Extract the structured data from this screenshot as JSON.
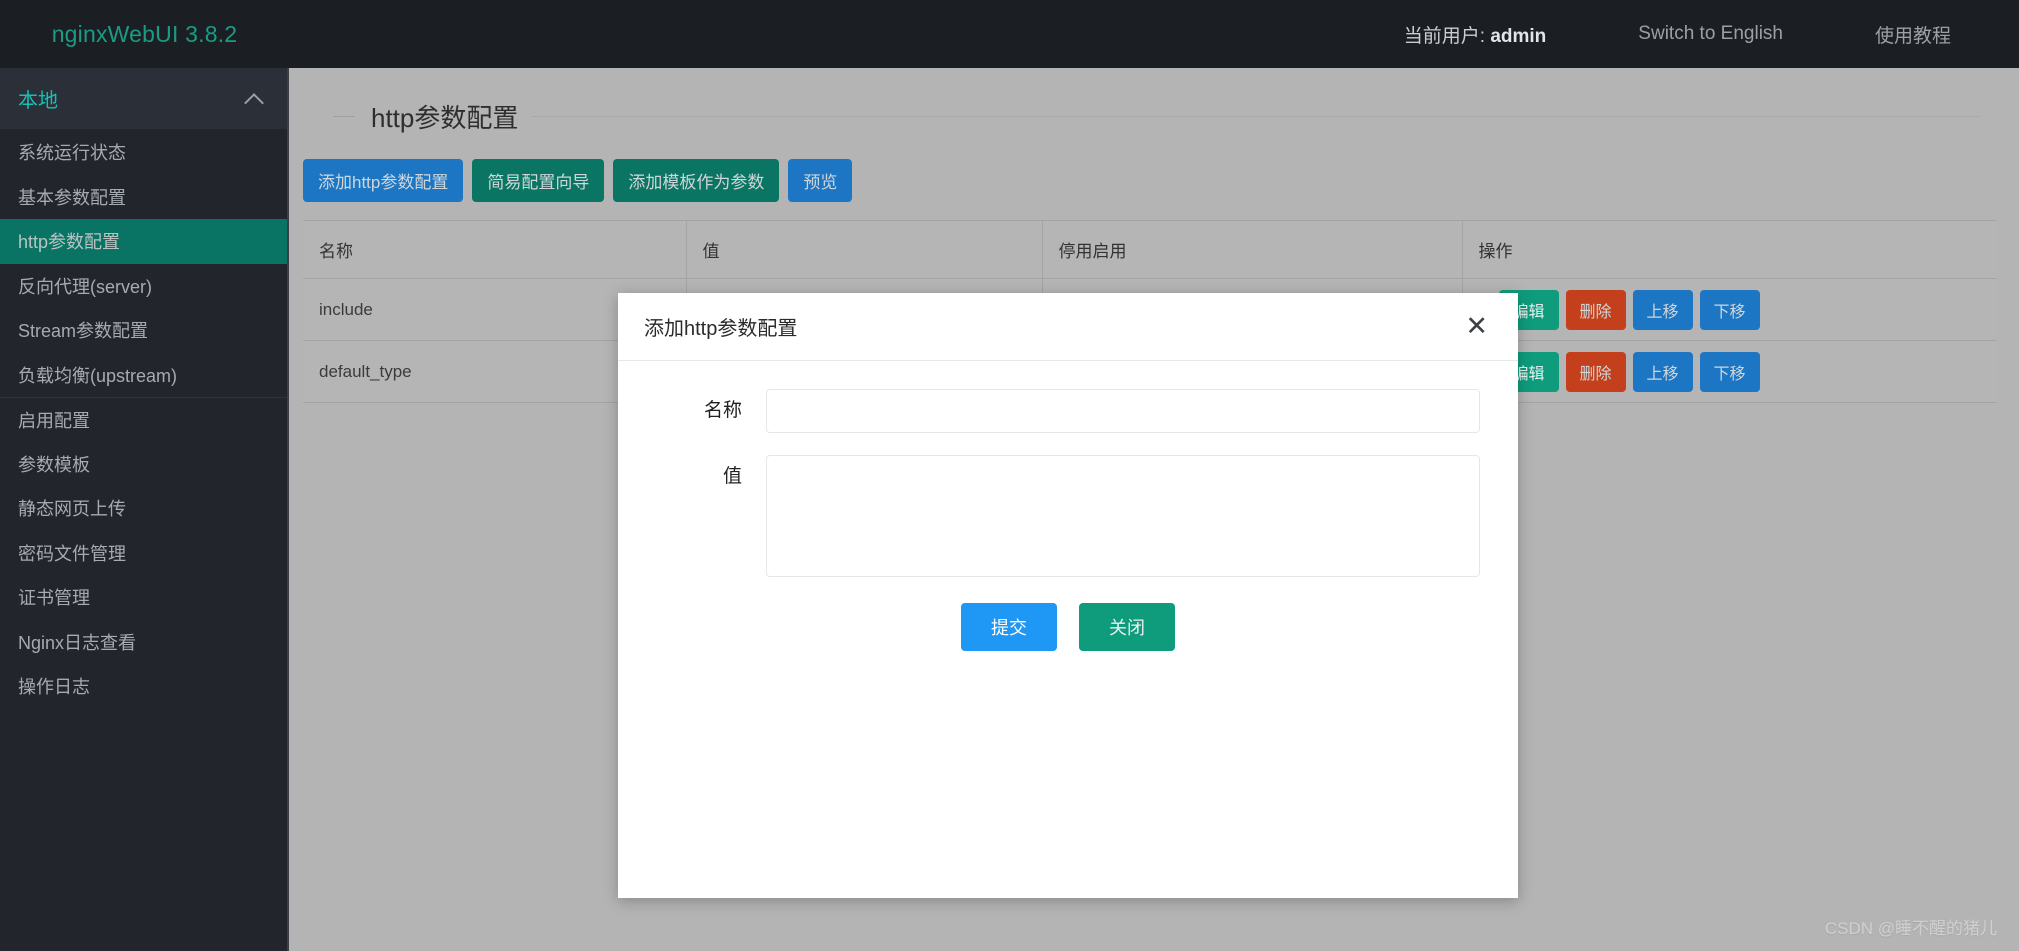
{
  "header": {
    "brand": "nginxWebUI 3.8.2",
    "nav": [
      {
        "label": "当前用户: admin",
        "name": "current-user"
      },
      {
        "label": "Switch to English",
        "name": "switch-language"
      },
      {
        "label": "使用教程",
        "name": "tutorial-link"
      }
    ]
  },
  "sidebar": {
    "section_label": "本地",
    "items": [
      {
        "label": "系统运行状态",
        "active": false
      },
      {
        "label": "基本参数配置",
        "active": false
      },
      {
        "label": "http参数配置",
        "active": true
      },
      {
        "label": "反向代理(server)",
        "active": false
      },
      {
        "label": "Stream参数配置",
        "active": false
      },
      {
        "label": "负载均衡(upstream)",
        "active": false
      },
      {
        "label": "启用配置",
        "active": false
      },
      {
        "label": "参数模板",
        "active": false
      },
      {
        "label": "静态网页上传",
        "active": false
      },
      {
        "label": "密码文件管理",
        "active": false
      },
      {
        "label": "证书管理",
        "active": false
      },
      {
        "label": "Nginx日志查看",
        "active": false
      },
      {
        "label": "操作日志",
        "active": false
      }
    ]
  },
  "main": {
    "page_title": "http参数配置",
    "toolbar": [
      {
        "label": "添加http参数配置",
        "style": "blue"
      },
      {
        "label": "简易配置向导",
        "style": "teal"
      },
      {
        "label": "添加模板作为参数",
        "style": "teal"
      },
      {
        "label": "预览",
        "style": "blue"
      }
    ],
    "table": {
      "columns": [
        "名称",
        "值",
        "停用启用",
        "操作"
      ],
      "row_actions": [
        {
          "label": "编辑",
          "style": "green"
        },
        {
          "label": "删除",
          "style": "red"
        },
        {
          "label": "上移",
          "style": "blue"
        },
        {
          "label": "下移",
          "style": "blue"
        }
      ],
      "rows": [
        {
          "name": "include",
          "value": "",
          "toggle": ""
        },
        {
          "name": "default_type",
          "value": "",
          "toggle": ""
        }
      ]
    }
  },
  "modal": {
    "title": "添加http参数配置",
    "close_icon": "close-icon",
    "fields": {
      "name_label": "名称",
      "name_value": "",
      "name_placeholder": "",
      "value_label": "值",
      "value_value": "",
      "value_placeholder": ""
    },
    "submit_label": "提交",
    "close_label": "关闭"
  },
  "watermark": "CSDN @睡不醒的猪儿",
  "colors": {
    "brand_teal": "#1a9c84",
    "sidebar_active": "#0a7464",
    "btn_blue": "#1d76c4",
    "btn_teal": "#0b7563",
    "btn_green": "#0e9c7c",
    "btn_red": "#c4401c",
    "btn_submit": "#1f97f5",
    "topbar_bg": "#1b1f23",
    "sidebar_bg": "#22262c",
    "content_bg": "#b4b4b4"
  }
}
